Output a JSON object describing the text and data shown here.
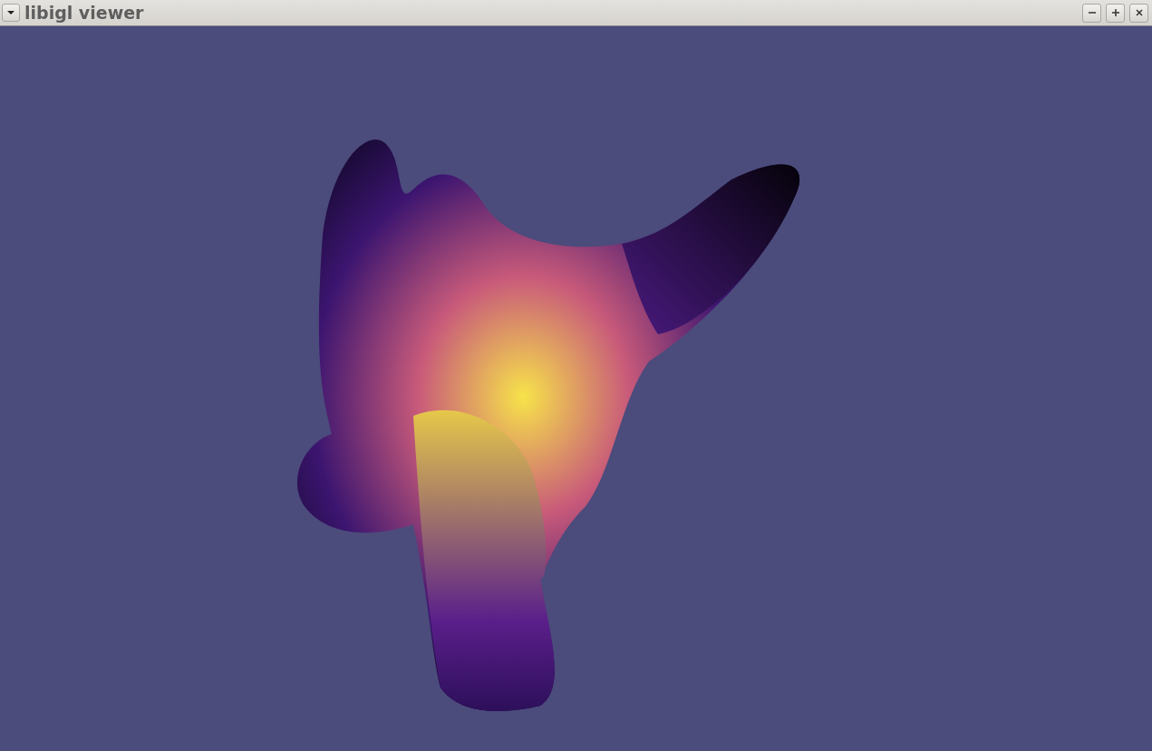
{
  "window": {
    "title": "libigl viewer"
  }
}
